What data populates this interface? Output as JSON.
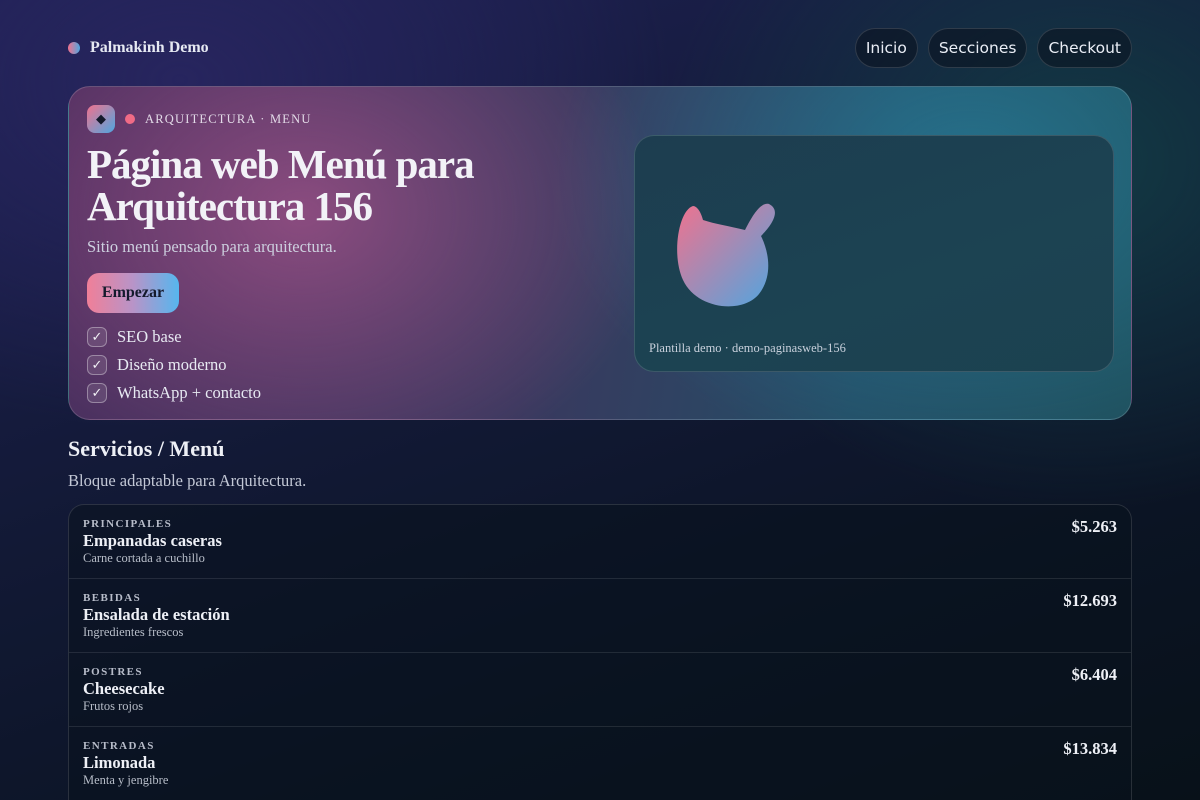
{
  "header": {
    "brand": "Palmakinh Demo",
    "nav": [
      "Inicio",
      "Secciones",
      "Checkout"
    ]
  },
  "hero": {
    "kicker_icon": "◆",
    "kicker": "ARQUITECTURA · MENU",
    "title": "Página web Menú para Arquitectura 156",
    "subtitle": "Sitio menú pensado para arquitectura.",
    "cta": "Empezar",
    "features": [
      "SEO base",
      "Diseño moderno",
      "WhatsApp + contacto"
    ],
    "check_glyph": "✓",
    "preview_caption": "Plantilla demo · demo-paginasweb-156"
  },
  "section": {
    "title": "Servicios / Menú",
    "subtitle": "Bloque adaptable para Arquitectura."
  },
  "menu": [
    {
      "category": "PRINCIPALES",
      "name": "Empanadas caseras",
      "desc": "Carne cortada a cuchillo",
      "price": "$5.263"
    },
    {
      "category": "BEBIDAS",
      "name": "Ensalada de estación",
      "desc": "Ingredientes frescos",
      "price": "$12.693"
    },
    {
      "category": "POSTRES",
      "name": "Cheesecake",
      "desc": "Frutos rojos",
      "price": "$6.404"
    },
    {
      "category": "ENTRADAS",
      "name": "Limonada",
      "desc": "Menta y jengibre",
      "price": "$13.834"
    }
  ],
  "colors": {
    "accent_pink": "#f0728e",
    "accent_blue": "#4fa6e0"
  },
  "icons": {
    "brand": "brand-dot-icon",
    "kicker": "diamond-icon",
    "check": "check-icon",
    "preview": "abstract-blob-icon"
  }
}
